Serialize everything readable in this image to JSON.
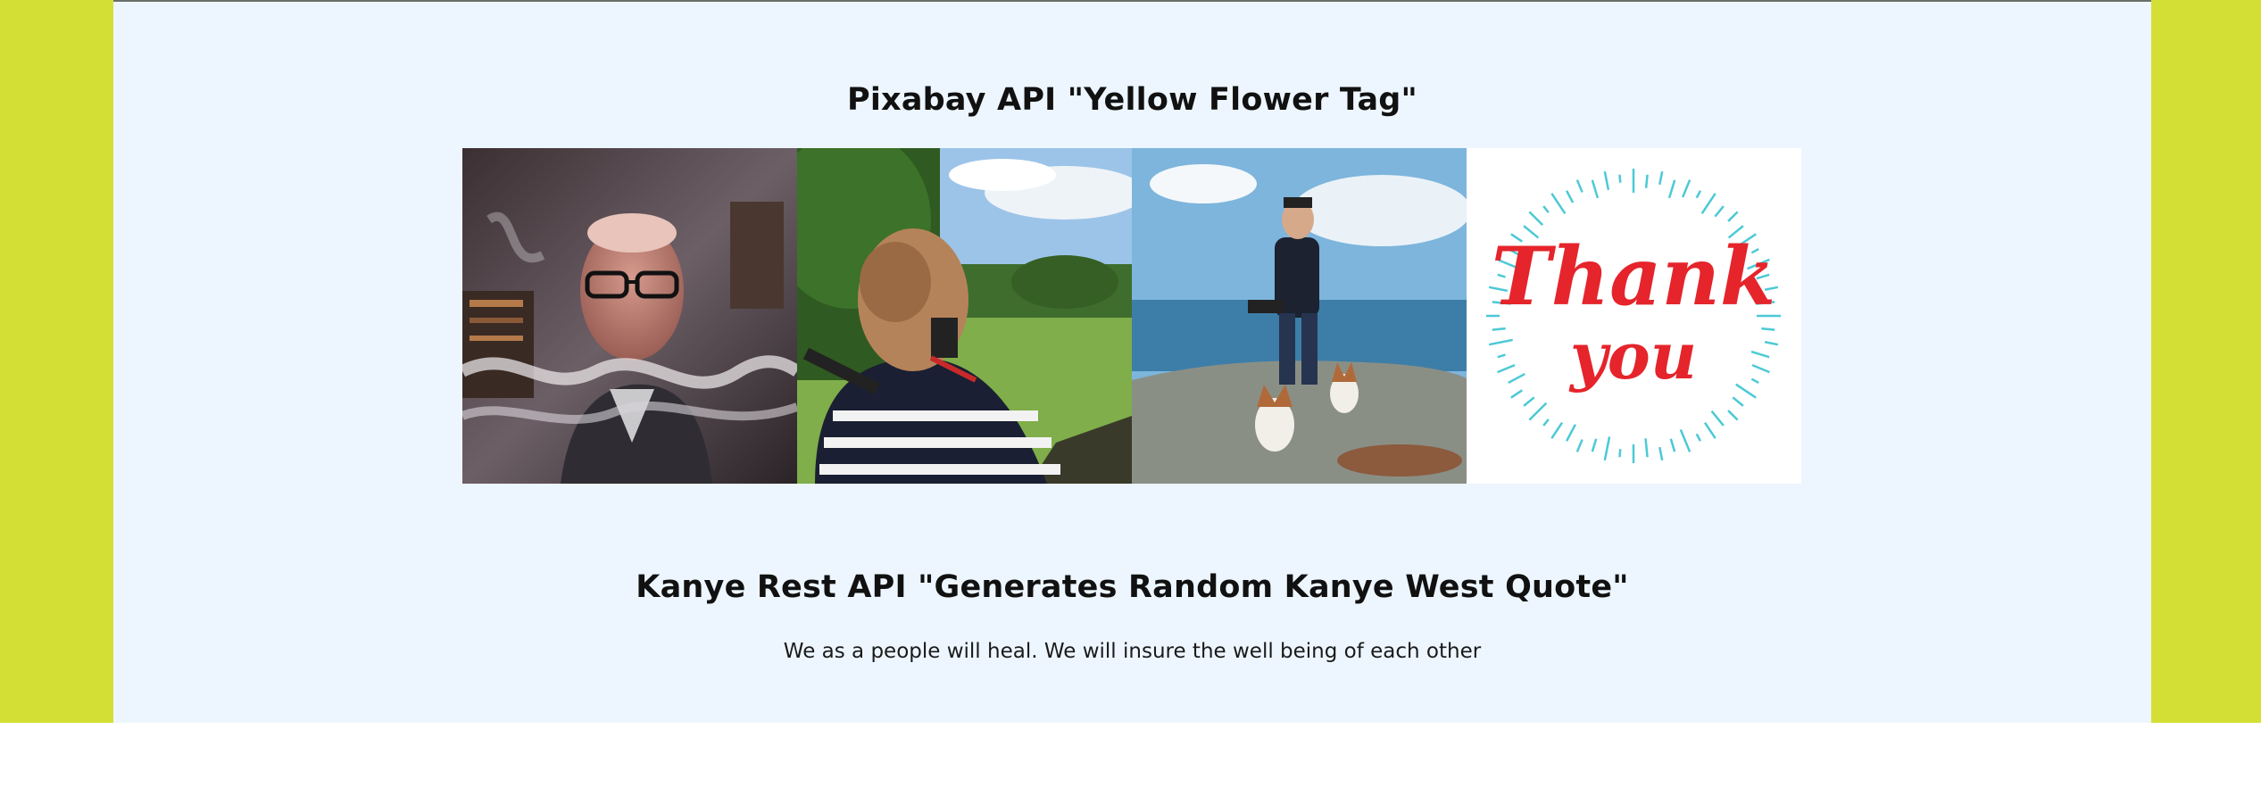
{
  "pixabay": {
    "title": "Pixabay API \"Yellow Flower Tag\"",
    "images": [
      {
        "description_icon": "old-man-smoke-photo"
      },
      {
        "description_icon": "woman-camera-photo"
      },
      {
        "description_icon": "man-dogs-cliff-photo"
      },
      {
        "description_icon": "thank-you-card-photo",
        "text_line1": "Thank",
        "text_line2": "you"
      }
    ]
  },
  "kanye": {
    "title": "Kanye Rest API \"Generates Random Kanye West Quote\"",
    "quote": "We as a people will heal. We will insure the well being of each other"
  },
  "colors": {
    "side_band": "#d4df35",
    "panel": "#edf6ff",
    "thank_you_red": "#e5242b",
    "burst_teal": "#4cc9d6"
  }
}
